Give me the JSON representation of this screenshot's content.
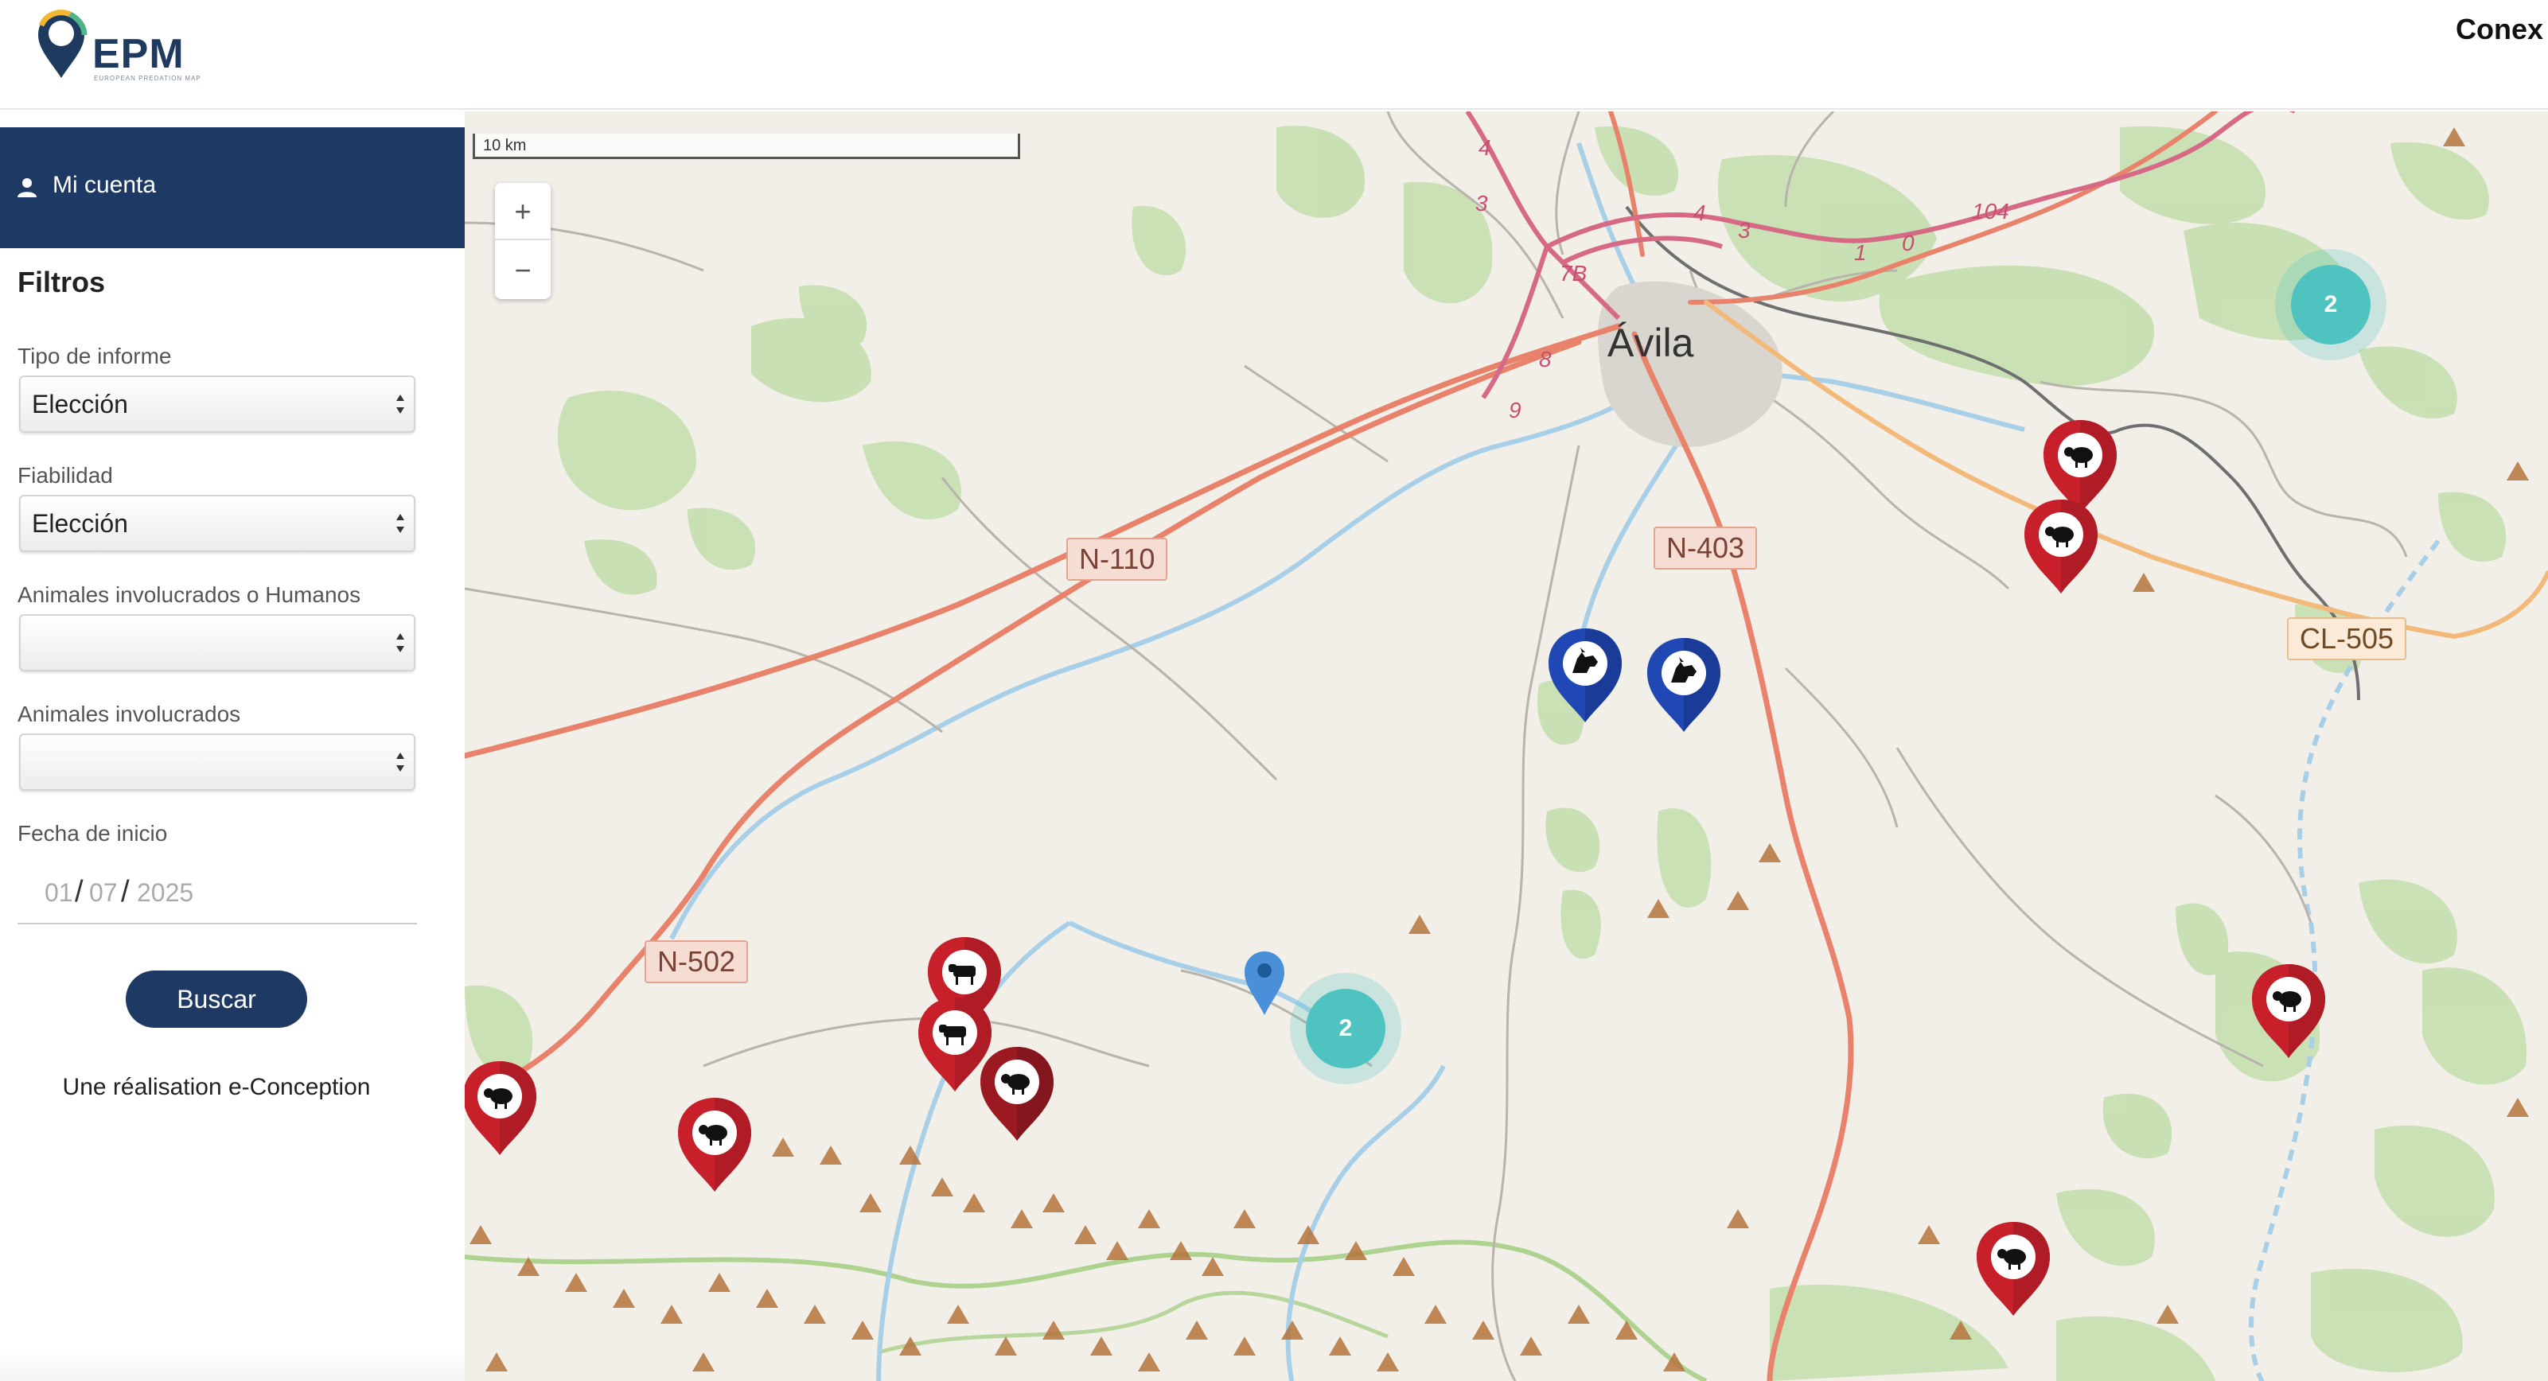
{
  "header": {
    "logo_text": "EPM",
    "logo_subtitle": "EUROPEAN PREDATION MAP",
    "connect_label": "Conex"
  },
  "sidebar": {
    "account_label": "Mi cuenta",
    "filters_title": "Filtros",
    "fields": [
      {
        "label": "Tipo de informe",
        "value": "Elección"
      },
      {
        "label": "Fiabilidad",
        "value": "Elección"
      },
      {
        "label": "Animales involucrados o Humanos",
        "value": ""
      },
      {
        "label": "Animales involucrados",
        "value": ""
      }
    ],
    "date": {
      "label": "Fecha de inicio",
      "day": "01",
      "month": "07",
      "year": "2025"
    },
    "search_button": "Buscar",
    "credit": "Une réalisation e-Conception"
  },
  "map": {
    "scale_label": "10 km",
    "zoom_in": "+",
    "zoom_out": "−",
    "city_label": "Ávila",
    "road_labels": {
      "n110": "N-110",
      "n403": "N-403",
      "n502": "N-502",
      "cl505": "CL-505"
    },
    "route_numbers": [
      "4",
      "3",
      "7B",
      "8",
      "9",
      "4",
      "3",
      "1",
      "0",
      "104"
    ],
    "clusters": [
      {
        "count": "2"
      },
      {
        "count": "2"
      }
    ],
    "colors": {
      "livestock_marker": "#c8202a",
      "livestock_marker_dark": "#9b1a22",
      "wolf_marker": "#1f48b4",
      "location_pin": "#4a90d9",
      "cluster": "#4fc3c0",
      "sidebar_accent": "#1e3a64",
      "road_primary": "#e8826a",
      "road_secondary": "#f2b97a",
      "forest": "#c5dfb0",
      "water": "#a8cfe8"
    },
    "icons": {
      "livestock": "sheep-icon",
      "cattle": "cow-icon",
      "predator": "wolf-icon"
    }
  }
}
